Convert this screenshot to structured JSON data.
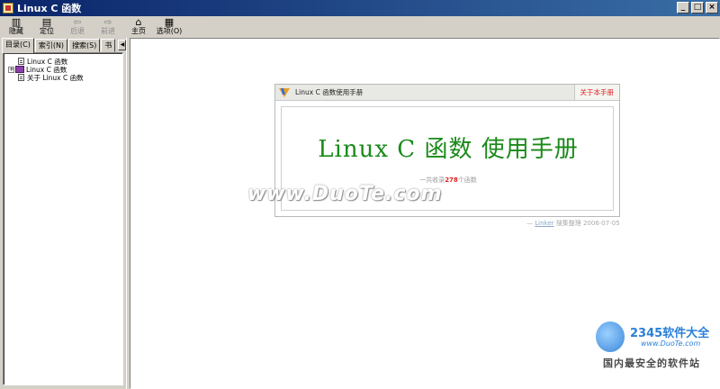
{
  "window": {
    "title": "Linux C 函数",
    "controls": {
      "minimize": "_",
      "maximize": "□",
      "close": "×"
    }
  },
  "toolbar": {
    "buttons": [
      {
        "label": "隐藏",
        "icon": "hide-pane-icon",
        "enabled": true
      },
      {
        "label": "定位",
        "icon": "locate-icon",
        "enabled": true
      },
      {
        "label": "后退",
        "icon": "back-arrow-icon",
        "enabled": false
      },
      {
        "label": "前进",
        "icon": "forward-arrow-icon",
        "enabled": false
      },
      {
        "label": "主页",
        "icon": "home-icon",
        "enabled": true
      },
      {
        "label": "选项(O)",
        "icon": "options-icon",
        "enabled": true
      }
    ]
  },
  "nav_tabs": [
    {
      "label": "目录(C)",
      "active": true
    },
    {
      "label": "索引(N)",
      "active": false
    },
    {
      "label": "搜索(S)",
      "active": false
    },
    {
      "label": "书",
      "active": false
    }
  ],
  "tree": [
    {
      "label": "Linux C 函数",
      "icon": "page-icon",
      "expandable": false
    },
    {
      "label": "Linux C 函数",
      "icon": "book-icon",
      "expandable": true,
      "expander": "+"
    },
    {
      "label": "关于 Linux C 函数",
      "icon": "page-icon",
      "expandable": false
    }
  ],
  "manual": {
    "header_title": "Linux C 函数使用手册",
    "about_link": "关于本手册",
    "title": "Linux C 函数 使用手册",
    "count_prefix": "一共收录",
    "count": "278",
    "count_suffix": "个函数",
    "footer_prefix": "— ",
    "footer_author": "Linker",
    "footer_suffix": " 搜集整理 2006-07-05"
  },
  "watermarks": {
    "duote": "www.DuoTe.com",
    "brand": "2345软件大全",
    "brand_url": "www.DuoTe.com",
    "slogan": "国内最安全的软件站"
  },
  "colors": {
    "title_green": "#1a8a1a",
    "link_red": "#e02020",
    "titlebar_blue": "#0a246a"
  }
}
